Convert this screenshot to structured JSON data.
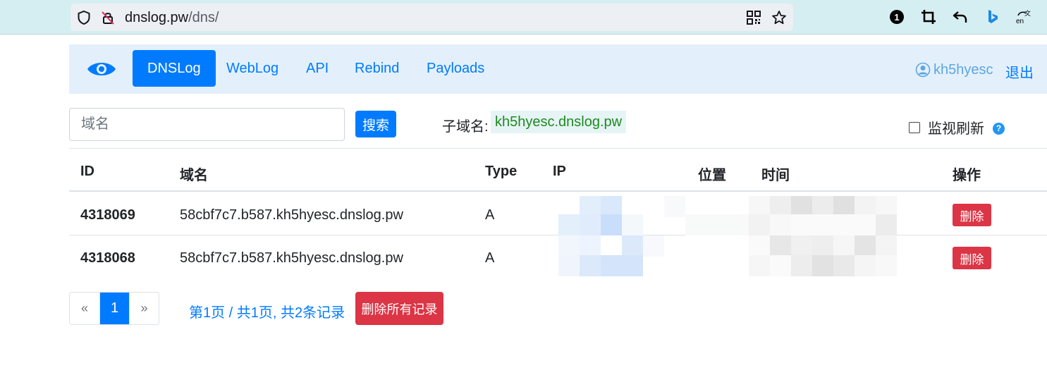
{
  "browser": {
    "url_host": "dnslog.pw",
    "url_path": "/dns/",
    "extension_badge": "1"
  },
  "navbar": {
    "items": [
      {
        "label": "DNSLog",
        "active": true
      },
      {
        "label": "WebLog"
      },
      {
        "label": "API"
      },
      {
        "label": "Rebind"
      },
      {
        "label": "Payloads"
      }
    ],
    "username": "kh5hyesc",
    "logout_label": "退出"
  },
  "search": {
    "placeholder": "域名",
    "button_label": "搜索",
    "subdomain_label": "子域名:",
    "subdomain_value": "kh5hyesc.dnslog.pw",
    "monitor_label": "监视刷新",
    "help_glyph": "?"
  },
  "table": {
    "headers": {
      "id": "ID",
      "domain": "域名",
      "type": "Type",
      "ip": "IP",
      "location": "位置",
      "time": "时间",
      "action": "操作"
    },
    "rows": [
      {
        "id": "4318069",
        "domain": "58cbf7c7.b587.kh5hyesc.dnslog.pw",
        "type": "A",
        "action": "删除"
      },
      {
        "id": "4318068",
        "domain": "58cbf7c7.b587.kh5hyesc.dnslog.pw",
        "type": "A",
        "action": "删除"
      }
    ]
  },
  "pagination": {
    "prev": "«",
    "current": "1",
    "next": "»",
    "info": "第1页 / 共1页, 共2条记录",
    "delete_all_label": "删除所有记录"
  },
  "colors": {
    "primary": "#007bff",
    "danger": "#dc3545",
    "navbar_bg": "#e3f0fb",
    "subdomain_text": "#1e8a1e"
  }
}
